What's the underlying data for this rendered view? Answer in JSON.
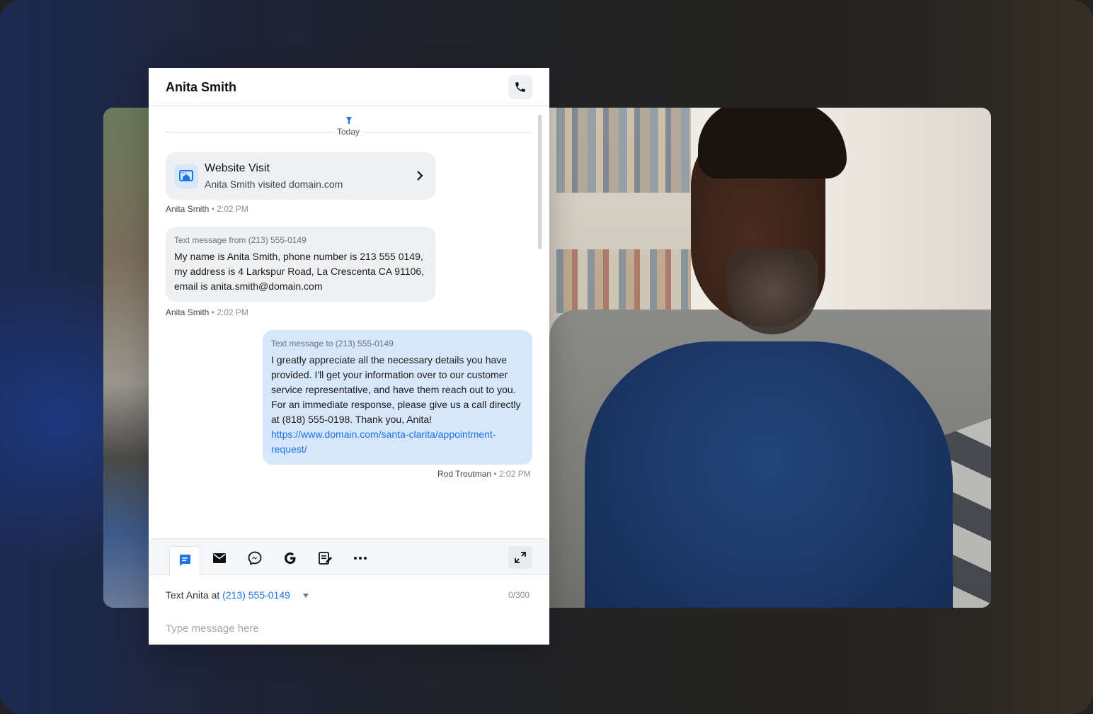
{
  "header": {
    "title": "Anita Smith"
  },
  "thread": {
    "day_label": "Today",
    "visit_card": {
      "title": "Website Visit",
      "subtitle": "Anita Smith visited domain.com",
      "author": "Anita Smith",
      "time": "• 2:02 PM"
    },
    "incoming": {
      "label": "Text message from (213) 555-0149",
      "text": "My name is Anita Smith, phone number is 213 555 0149, my address is 4 Larkspur Road, La Crescenta CA 91106, email is anita.smith@domain.com",
      "author": "Anita Smith",
      "time": "• 2:02 PM"
    },
    "outgoing": {
      "label": "Text message to (213) 555-0149",
      "text": "I greatly appreciate all the necessary details you have provided. I'll get your information over to our customer service representative, and have them reach out to you. For an immediate response, please give us a call directly at (818) 555-0198. Thank you, Anita!",
      "link": "https://www.domain.com/santa-clarita/appointment-request/",
      "author": "Rod Troutman",
      "time": "• 2:02 PM"
    }
  },
  "composer": {
    "tools": [
      "sms-icon",
      "email-icon",
      "messenger-icon",
      "google-icon",
      "note-icon",
      "more-icon",
      "expand-icon"
    ],
    "to_prefix": "Text Anita at",
    "to_number": "(213) 555-0149",
    "counter": "0/300",
    "placeholder": "Type message here"
  },
  "colors": {
    "accent": "#1a73e8",
    "outgoing_bubble": "#d7e7fb",
    "incoming_bubble": "#eff0f2"
  }
}
